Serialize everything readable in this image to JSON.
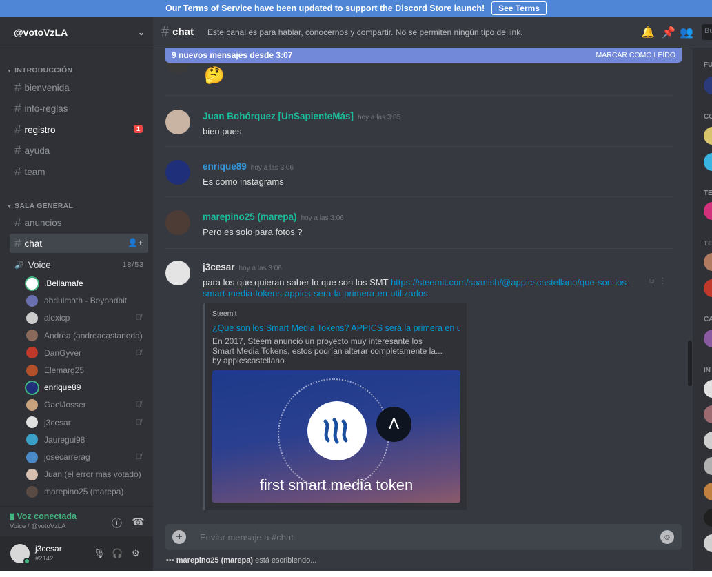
{
  "notice": {
    "text": "Our Terms of Service have been updated to support the Discord Store launch!",
    "button": "See Terms"
  },
  "guild": {
    "name": "@votoVzLA"
  },
  "categories": [
    {
      "name": "INTRODUCCIÓN"
    },
    {
      "name": "SALA GENERAL"
    }
  ],
  "channels": [
    {
      "name": "bienvenida"
    },
    {
      "name": "info-reglas"
    },
    {
      "name": "registro",
      "badge": "1"
    },
    {
      "name": "ayuda"
    },
    {
      "name": "team"
    },
    {
      "name": "anuncios"
    },
    {
      "name": "chat"
    }
  ],
  "voice": {
    "name": "Voice",
    "count": "18/53"
  },
  "voice_users": [
    {
      "name": ".Bellamafe",
      "color": "#ffffff"
    },
    {
      "name": "abdulmath - Beyondbit",
      "color": "#6a6fb0"
    },
    {
      "name": "alexicp",
      "color": "#cccccc"
    },
    {
      "name": "Andrea (andreacastaneda)",
      "color": "#8a6a5a"
    },
    {
      "name": "DanGyver",
      "color": "#c0392b"
    },
    {
      "name": "Elemarg25",
      "color": "#b2502a"
    },
    {
      "name": "enrique89",
      "color": "#1f2f7a"
    },
    {
      "name": "GaelJosser",
      "color": "#c9a27e"
    },
    {
      "name": "j3cesar",
      "color": "#e0e0e0"
    },
    {
      "name": "Jauregui98",
      "color": "#3aa0c8"
    },
    {
      "name": "josecarrerag",
      "color": "#4b8ac9"
    },
    {
      "name": "Juan (el error mas votado)",
      "color": "#d8c0b0"
    },
    {
      "name": "marepino25 (marepa)",
      "color": "#5a4a44"
    }
  ],
  "voice_connected": {
    "title": "Voz conectada",
    "sub": "Voice / @votoVzLA"
  },
  "me": {
    "name": "j3cesar",
    "disc": "#2142"
  },
  "header": {
    "channel": "chat",
    "topic": "Este canal es para hablar, conocernos y compartir. No se permiten ningún tipo de link.",
    "search": "Bu"
  },
  "newbar": {
    "left": "9 nuevos mensajes desde 3:07",
    "right": "MARCAR COMO LEÍDO"
  },
  "messages": [
    {
      "author": "Juan Bohórquez [UnSapienteMás]",
      "time": "hoy a las 3:05",
      "text": "bien pues",
      "color": "#1abc9c",
      "avatar": "#c9b3a3"
    },
    {
      "author": "enrique89",
      "time": "hoy a las 3:06",
      "text": "Es como instagrams",
      "color": "#3498db",
      "avatar": "#1f2f7a"
    },
    {
      "author": "marepino25 (marepa)",
      "time": "hoy a las 3:06",
      "text": "Pero es solo para fotos ?",
      "color": "#1abc9c",
      "avatar": "#4d3c36"
    },
    {
      "author": "j3cesar",
      "time": "hoy a las 3:06",
      "text": "para los que quieran saber lo que son los SMT ",
      "link": "https://steemit.com/spanish/@appicscastellano/que-son-los-smart-media-tokens-appics-sera-la-primera-en-utilizarlos",
      "color": "#dcddde",
      "avatar": "#e4e4e4"
    }
  ],
  "embed": {
    "provider": "Steemit",
    "title": "¿Que son los Smart Media Tokens? APPICS será la primera en utili...",
    "description": "En 2017, Steem anunció un proyecto muy interesante los Smart Media Tokens, estos podrían alterar completamente la... by appicscastellano",
    "image_caption": "first smart media token"
  },
  "input": {
    "placeholder": "Enviar mensaje a #chat"
  },
  "typing": {
    "user": "marepino25 (marepa)",
    "rest": " está escribiendo..."
  },
  "members": {
    "cats": [
      "FU",
      "CO",
      "TE",
      "TE",
      "CA",
      "IN"
    ]
  }
}
